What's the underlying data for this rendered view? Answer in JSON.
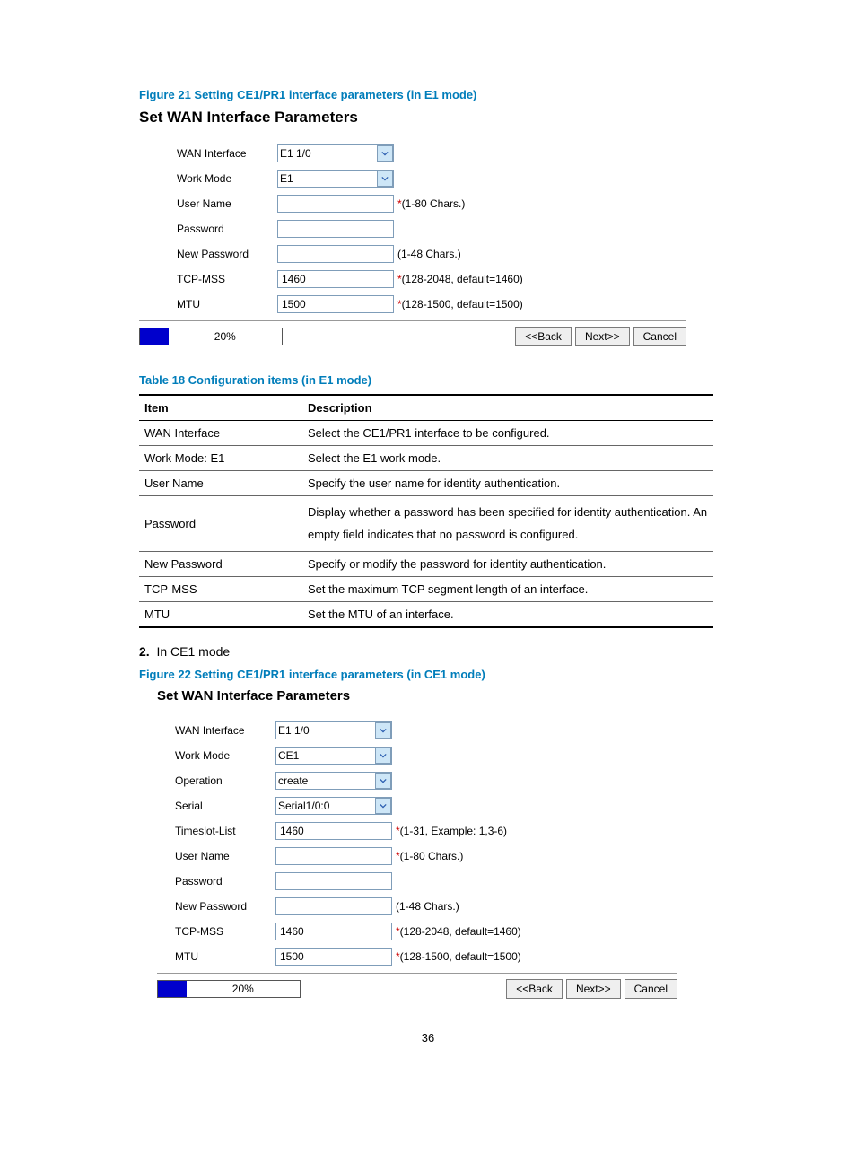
{
  "page_number": "36",
  "fig1": {
    "caption": "Figure 21 Setting CE1/PR1 interface parameters (in E1 mode)",
    "title": "Set WAN Interface Parameters",
    "rows": {
      "wan_iface": {
        "label": "WAN Interface",
        "value": "E1 1/0"
      },
      "work_mode": {
        "label": "Work Mode",
        "value": "E1"
      },
      "user_name": {
        "label": "User Name",
        "value": "",
        "hint": "(1-80 Chars.)"
      },
      "password": {
        "label": "Password",
        "value": "",
        "hint": ""
      },
      "new_password": {
        "label": "New Password",
        "value": "",
        "hint": "(1-48 Chars.)"
      },
      "tcp_mss": {
        "label": "TCP-MSS",
        "value": "1460",
        "hint": "(128-2048, default=1460)"
      },
      "mtu": {
        "label": "MTU",
        "value": "1500",
        "hint": "(128-1500, default=1500)"
      }
    },
    "progress": "20%",
    "buttons": {
      "back": "<<Back",
      "next": "Next>>",
      "cancel": "Cancel"
    }
  },
  "table18": {
    "caption": "Table 18 Configuration items (in E1 mode)",
    "headers": {
      "item": "Item",
      "desc": "Description"
    },
    "rows": [
      {
        "item": "WAN Interface",
        "desc": "Select the CE1/PR1 interface to be configured."
      },
      {
        "item": "Work Mode: E1",
        "desc": "Select the E1 work mode."
      },
      {
        "item": "User Name",
        "desc": "Specify the user name for identity authentication."
      },
      {
        "item": "Password",
        "desc": "Display whether a password has been specified for identity authentication. An empty field indicates that no password is configured."
      },
      {
        "item": "New Password",
        "desc": "Specify or modify the password for identity authentication."
      },
      {
        "item": "TCP-MSS",
        "desc": "Set the maximum TCP segment length of an interface."
      },
      {
        "item": "MTU",
        "desc": "Set the MTU of an interface."
      }
    ]
  },
  "step2": {
    "num": "2.",
    "text": "In CE1 mode"
  },
  "fig2": {
    "caption": "Figure 22 Setting CE1/PR1 interface parameters (in CE1 mode)",
    "title": "Set WAN Interface Parameters",
    "rows": {
      "wan_iface": {
        "label": "WAN Interface",
        "value": "E1 1/0"
      },
      "work_mode": {
        "label": "Work Mode",
        "value": "CE1"
      },
      "operation": {
        "label": "Operation",
        "value": "create"
      },
      "serial": {
        "label": "Serial",
        "value": "Serial1/0:0"
      },
      "timeslot": {
        "label": "Timeslot-List",
        "value": "1460",
        "hint": "(1-31, Example: 1,3-6)"
      },
      "user_name": {
        "label": "User Name",
        "value": "",
        "hint": "(1-80 Chars.)"
      },
      "password": {
        "label": "Password",
        "value": "",
        "hint": ""
      },
      "new_password": {
        "label": "New Password",
        "value": "",
        "hint": "(1-48 Chars.)"
      },
      "tcp_mss": {
        "label": "TCP-MSS",
        "value": "1460",
        "hint": "(128-2048, default=1460)"
      },
      "mtu": {
        "label": "MTU",
        "value": "1500",
        "hint": "(128-1500, default=1500)"
      }
    },
    "progress": "20%",
    "buttons": {
      "back": "<<Back",
      "next": "Next>>",
      "cancel": "Cancel"
    }
  }
}
